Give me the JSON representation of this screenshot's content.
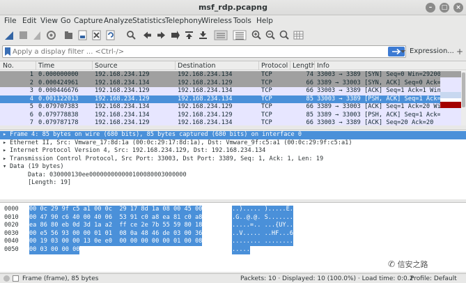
{
  "window": {
    "title": "msf_rdp.pcapng"
  },
  "menu": [
    "File",
    "Edit",
    "View",
    "Go",
    "Capture",
    "Analyze",
    "Statistics",
    "Telephony",
    "Wireless",
    "Tools",
    "Help"
  ],
  "filter": {
    "placeholder": "Apply a display filter ... <Ctrl-/>",
    "expression_label": "Expression..."
  },
  "packet_list": {
    "columns": [
      "No.",
      "Time",
      "Source",
      "Destination",
      "Protocol",
      "Length",
      "Info"
    ],
    "rows": [
      {
        "no": "1",
        "time": "0.000000000",
        "src": "192.168.234.129",
        "dst": "192.168.234.134",
        "proto": "TCP",
        "len": "74",
        "info": "33003 → 3389 [SYN] Seq=0 Win=29200",
        "bg": "#a0a0a0",
        "fg": "#12272e"
      },
      {
        "no": "2",
        "time": "0.000424961",
        "src": "192.168.234.134",
        "dst": "192.168.234.129",
        "proto": "TCP",
        "len": "66",
        "info": "3389 → 33003 [SYN, ACK] Seq=0 Ack=1",
        "bg": "#a0a0a0",
        "fg": "#12272e"
      },
      {
        "no": "3",
        "time": "0.000446676",
        "src": "192.168.234.129",
        "dst": "192.168.234.134",
        "proto": "TCP",
        "len": "66",
        "info": "33003 → 3389 [ACK] Seq=1 Ack=1 Win",
        "bg": "#e7e6ff",
        "fg": "#12272e"
      },
      {
        "no": "4",
        "time": "0.001122013",
        "src": "192.168.234.129",
        "dst": "192.168.234.134",
        "proto": "TCP",
        "len": "85",
        "info": "33003 → 3389 [PSH, ACK] Seq=1 Ack=",
        "bg": "#4a90d9",
        "fg": "#ffffff"
      },
      {
        "no": "5",
        "time": "0.079707383",
        "src": "192.168.234.134",
        "dst": "192.168.234.129",
        "proto": "TCP",
        "len": "66",
        "info": "3389 → 33003 [ACK] Seq=1 Ack=20 Wi",
        "bg": "#e7e6ff",
        "fg": "#12272e"
      },
      {
        "no": "6",
        "time": "0.079778838",
        "src": "192.168.234.134",
        "dst": "192.168.234.129",
        "proto": "TCP",
        "len": "85",
        "info": "3389 → 33003 [PSH, ACK] Seq=1 Ack=",
        "bg": "#e7e6ff",
        "fg": "#12272e"
      },
      {
        "no": "7",
        "time": "0.079787178",
        "src": "192.168.234.129",
        "dst": "192.168.234.134",
        "proto": "TCP",
        "len": "66",
        "info": "33003 → 3389 [ACK] Seq=20 Ack=20",
        "bg": "#e7e6ff",
        "fg": "#12272e"
      }
    ]
  },
  "details": [
    {
      "arrow": "▸",
      "text": "Frame 4: 85 bytes on wire (680 bits), 85 bytes captured (680 bits) on interface 0",
      "indent": 0,
      "selected": true
    },
    {
      "arrow": "▸",
      "text": "Ethernet II, Src: Vmware_17:8d:1a (00:0c:29:17:8d:1a), Dst: Vmware_9f:c5:a1 (00:0c:29:9f:c5:a1)",
      "indent": 0,
      "selected": false
    },
    {
      "arrow": "▸",
      "text": "Internet Protocol Version 4, Src: 192.168.234.129, Dst: 192.168.234.134",
      "indent": 0,
      "selected": false
    },
    {
      "arrow": "▸",
      "text": "Transmission Control Protocol, Src Port: 33003, Dst Port: 3389, Seq: 1, Ack: 1, Len: 19",
      "indent": 0,
      "selected": false
    },
    {
      "arrow": "▾",
      "text": "Data (19 bytes)",
      "indent": 0,
      "selected": false
    },
    {
      "arrow": "",
      "text": "Data: 030000130ee000000000000100080003000000",
      "indent": 1,
      "selected": false
    },
    {
      "arrow": "",
      "text": "[Length: 19]",
      "indent": 1,
      "selected": false
    }
  ],
  "bytes": [
    {
      "offset": "0000",
      "hex": "00 0c 29 9f c5 a1 00 0c  29 17 8d 1a 08 00 45 00",
      "ascii": "..)..... ).....E."
    },
    {
      "offset": "0010",
      "hex": "00 47 90 c6 40 00 40 06  53 91 c0 a8 ea 81 c0 a8",
      "ascii": ".G..@.@. S......."
    },
    {
      "offset": "0020",
      "hex": "ea 86 80 eb 0d 3d 1a a2  ff ce 2e 7b 55 59 80 18",
      "ascii": ".....=.. ...{UY.."
    },
    {
      "offset": "0030",
      "hex": "00 e5 56 93 00 00 01 01  08 0a 48 46 de 03 00 36",
      "ascii": "..V..... ..HF...6"
    },
    {
      "offset": "0040",
      "hex": "00 19 03 00 00 13 0e e0  00 00 00 00 00 01 00 08",
      "ascii": "........ ........"
    },
    {
      "offset": "0050",
      "hex": "00 03 00 00 00",
      "ascii": "....."
    }
  ],
  "status": {
    "frame": "Frame (frame), 85 bytes",
    "packets": "Packets: 10 · Displayed: 10 (100.0%) · Load time: 0:0.2",
    "profile": "Profile: Default"
  },
  "watermark": "信安之路",
  "colors": {
    "selected": "#4a90d9",
    "tcp_row": "#e7e6ff",
    "syn_row": "#a0a0a0"
  }
}
